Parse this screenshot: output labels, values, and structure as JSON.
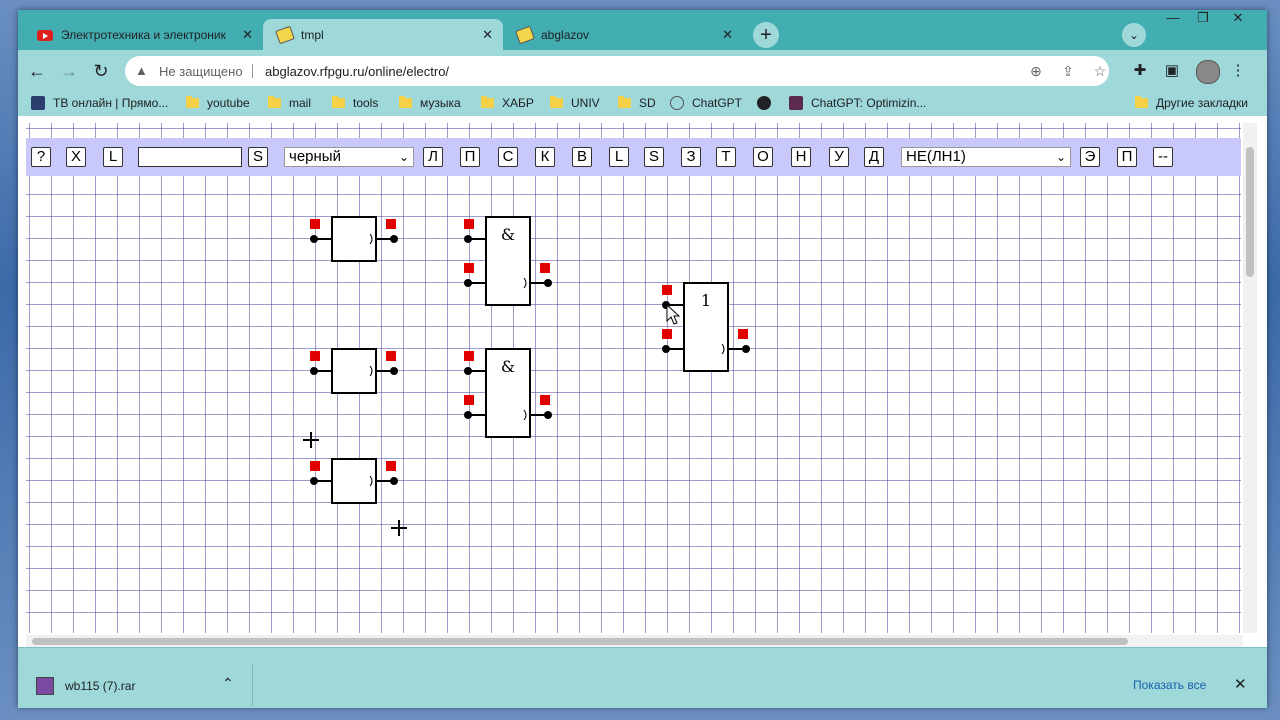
{
  "window": {
    "controls": [
      "—",
      "❐",
      "✕"
    ]
  },
  "tabs": [
    {
      "title": "Электротехника и электроника",
      "icon": "youtube-icon",
      "active": false
    },
    {
      "title": "tmpl",
      "icon": "tag-icon",
      "active": true
    },
    {
      "title": "abglazov",
      "icon": "tag-icon",
      "active": false
    }
  ],
  "toolbar": {
    "not_secure": "Не защищено",
    "url": "abglazov.rfpgu.ru/online/electro/"
  },
  "bookmarks": [
    {
      "label": "ТВ онлайн | Прямо...",
      "icon": "tv-icon"
    },
    {
      "label": "youtube",
      "icon": "folder-icon"
    },
    {
      "label": "mail",
      "icon": "folder-icon"
    },
    {
      "label": "tools",
      "icon": "folder-icon"
    },
    {
      "label": "музыка",
      "icon": "folder-icon"
    },
    {
      "label": "ХАБР",
      "icon": "folder-icon"
    },
    {
      "label": "UNIV",
      "icon": "folder-icon"
    },
    {
      "label": "SD",
      "icon": "folder-icon"
    },
    {
      "label": "ChatGPT",
      "icon": "chatgpt-icon"
    },
    {
      "label": "",
      "icon": "globe-icon"
    },
    {
      "label": "ChatGPT: Optimizin...",
      "icon": "chatgpt-icon"
    },
    {
      "label": "Другие закладки",
      "icon": "folder-icon"
    }
  ],
  "editor": {
    "buttons_left": [
      "?",
      "X",
      "L"
    ],
    "text_input_value": "",
    "save_button": "S",
    "color_select": "черный",
    "buttons_mid": [
      "Л",
      "П",
      "С",
      "К",
      "В",
      "L",
      "S",
      "З",
      "Т",
      "О",
      "Н",
      "У",
      "Д"
    ],
    "element_select": "НЕ(ЛН1)",
    "buttons_right": [
      "Э",
      "П",
      "--"
    ]
  },
  "gates": [
    {
      "kind": "buffer",
      "label": ""
    },
    {
      "kind": "buffer",
      "label": ""
    },
    {
      "kind": "buffer",
      "label": ""
    },
    {
      "kind": "and",
      "label": "&"
    },
    {
      "kind": "and",
      "label": "&"
    },
    {
      "kind": "or",
      "label": "1"
    }
  ],
  "downloads": {
    "file": "wb115 (7).rar",
    "show_all": "Показать все"
  }
}
